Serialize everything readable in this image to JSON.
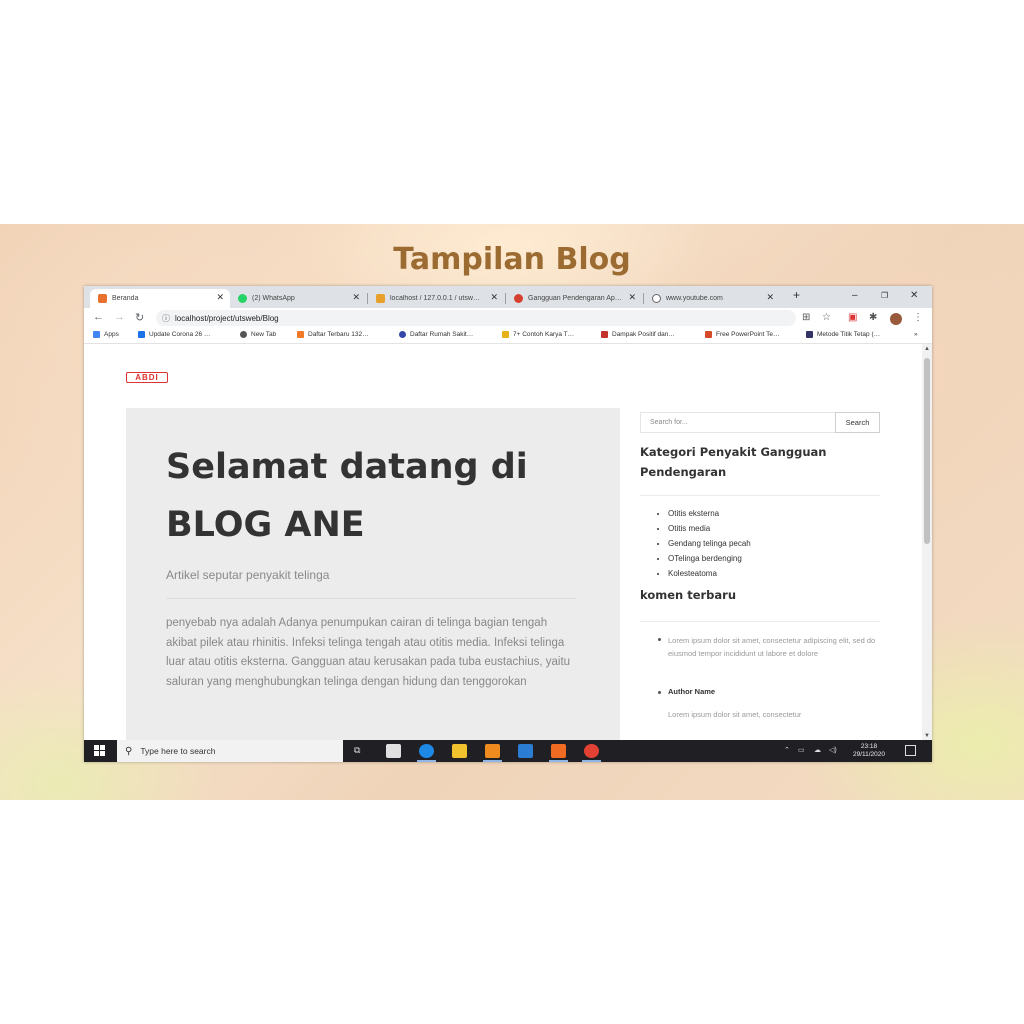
{
  "slide": {
    "title": "Tampilan Blog"
  },
  "browser": {
    "tabs": [
      {
        "label": "Beranda",
        "active": true,
        "color": "#e8712f"
      },
      {
        "label": "(2) WhatsApp",
        "active": false,
        "color": "#25d366"
      },
      {
        "label": "localhost / 127.0.0.1 / utsw…",
        "active": false,
        "color": "#e9a02b"
      },
      {
        "label": "Gangguan Pendengaran Ap…",
        "active": false,
        "color": "#d6402f"
      },
      {
        "label": "www.youtube.com",
        "active": false,
        "color": "#666666"
      }
    ],
    "url": "localhost/project/utsweb/Blog",
    "bookmarks": [
      {
        "label": "Apps",
        "color": "#4285f4"
      },
      {
        "label": "Update Corona 26 …",
        "color": "#1a73e8"
      },
      {
        "label": "New Tab",
        "color": "#555555"
      },
      {
        "label": "Daftar Terbaru 132…",
        "color": "#f07a28"
      },
      {
        "label": "Daftar Rumah Sakit…",
        "color": "#3446a8"
      },
      {
        "label": "7+ Contoh Karya T…",
        "color": "#e8b01a"
      },
      {
        "label": "Dampak Positif dan…",
        "color": "#c2332c"
      },
      {
        "label": "Free PowerPoint Te…",
        "color": "#d64a2a"
      },
      {
        "label": "Metode Titik Tetap (…",
        "color": "#333366"
      }
    ]
  },
  "page": {
    "logo": "ABDI",
    "hero": {
      "title_line1": "Selamat datang di",
      "title_line2": "BLOG ANE",
      "subtitle": "Artikel seputar penyakit telinga",
      "body": "penyebab nya adalah Adanya penumpukan cairan di telinga bagian tengah akibat pilek atau rhinitis. Infeksi telinga tengah atau otitis media. Infeksi telinga luar atau otitis eksterna. Gangguan atau kerusakan pada tuba eustachius, yaitu saluran yang menghubungkan telinga dengan hidung dan tenggorokan"
    },
    "sidebar": {
      "search_placeholder": "Search for...",
      "search_button": "Search",
      "categories_heading": "Kategori Penyakit Gangguan Pendengaran",
      "categories": [
        "Otitis eksterna",
        "Otitis media",
        "Gendang telinga pecah",
        "OTelinga berdenging",
        "Kolesteatoma"
      ],
      "recent_heading": "komen terbaru",
      "comments": [
        {
          "text": "Lorem ipsum dolor sit amet, consectetur adipiscing elit, sed do eiusmod tempor incididunt ut labore et dolore",
          "author": "Author Name"
        },
        {
          "text": "Lorem ipsum dolor sit amet, consectetur"
        }
      ]
    }
  },
  "taskbar": {
    "search_placeholder": "Type here to search",
    "time": "23:18",
    "date": "29/11/2020"
  }
}
